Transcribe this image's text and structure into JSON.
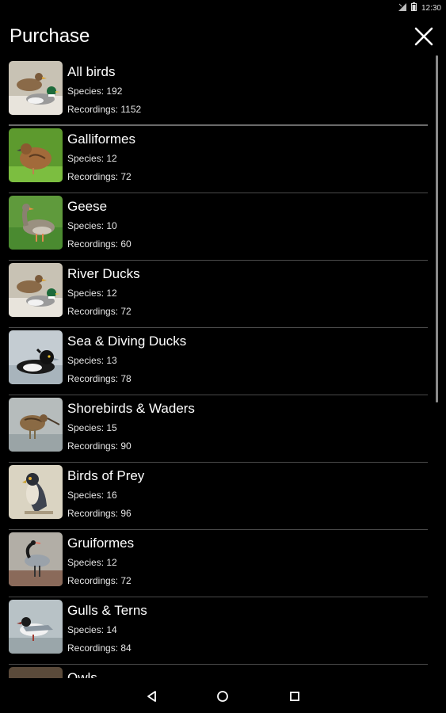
{
  "status_bar": {
    "time": "12:30"
  },
  "header": {
    "title": "Purchase"
  },
  "species_prefix": "Species: ",
  "recordings_prefix": "Recordings: ",
  "items": [
    {
      "title": "All birds",
      "species_label": "Species: 192",
      "recordings_label": "Recordings: 1152",
      "thumbnail": "ducks"
    },
    {
      "title": "Galliformes",
      "species_label": "Species: 12",
      "recordings_label": "Recordings: 72",
      "thumbnail": "quail"
    },
    {
      "title": "Geese",
      "species_label": "Species: 10",
      "recordings_label": "Recordings: 60",
      "thumbnail": "goose"
    },
    {
      "title": "River Ducks",
      "species_label": "Species: 12",
      "recordings_label": "Recordings: 72",
      "thumbnail": "ducks"
    },
    {
      "title": "Sea & Diving Ducks",
      "species_label": "Species: 13",
      "recordings_label": "Recordings: 78",
      "thumbnail": "tufted-duck"
    },
    {
      "title": "Shorebirds & Waders",
      "species_label": "Species: 15",
      "recordings_label": "Recordings: 90",
      "thumbnail": "snipe"
    },
    {
      "title": "Birds of Prey",
      "species_label": "Species: 16",
      "recordings_label": "Recordings: 96",
      "thumbnail": "falcon"
    },
    {
      "title": "Gruiformes",
      "species_label": "Species: 12",
      "recordings_label": "Recordings: 72",
      "thumbnail": "crane"
    },
    {
      "title": "Gulls & Terns",
      "species_label": "Species: 14",
      "recordings_label": "Recordings: 84",
      "thumbnail": "gull"
    },
    {
      "title": "Owls",
      "species_label": "",
      "recordings_label": "",
      "thumbnail": "owl"
    }
  ],
  "colors": {
    "background": "#000000",
    "text": "#ffffff",
    "divider": "#4a4a4a",
    "scrollbar": "#8a8a8a"
  },
  "icons": {
    "close": "close-icon",
    "back": "back-icon",
    "home": "home-icon",
    "recents": "recents-icon"
  }
}
